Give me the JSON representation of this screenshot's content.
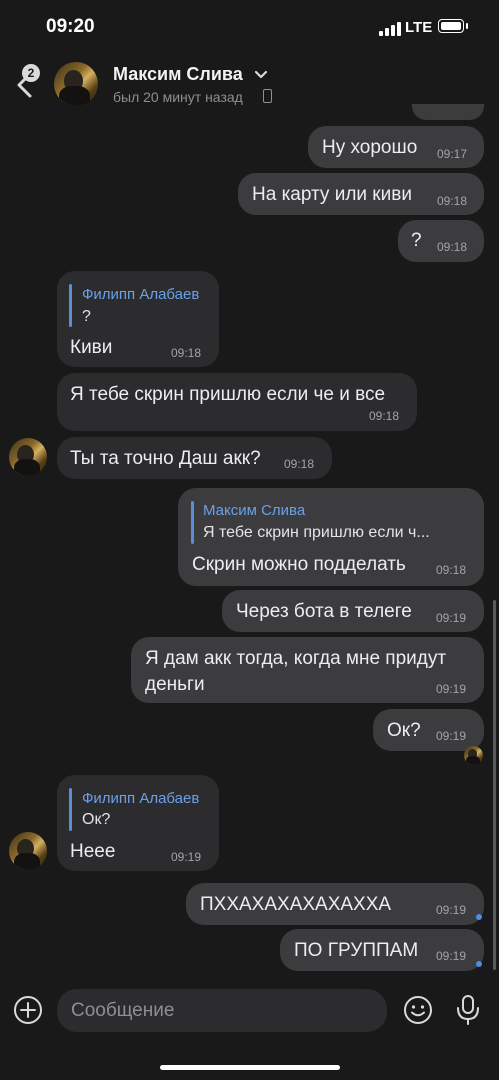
{
  "status_bar": {
    "time": "09:20",
    "network": "LTE"
  },
  "header": {
    "back_badge": "2",
    "contact_name": "Максим Слива",
    "contact_status": "был 20 минут назад"
  },
  "messages": [
    {
      "dir": "out",
      "text": "Ну хорошо",
      "time": "09:17"
    },
    {
      "dir": "out",
      "text": "На карту или киви",
      "time": "09:18"
    },
    {
      "dir": "out",
      "text": "?",
      "time": "09:18"
    },
    {
      "dir": "in",
      "reply_author": "Филипп Алабаев",
      "reply_text": "?",
      "text": "Киви",
      "time": "09:18"
    },
    {
      "dir": "in",
      "text": "Я тебе скрин пришлю если че и все",
      "time": "09:18"
    },
    {
      "dir": "in",
      "text": "Ты та точно Даш акк?",
      "time": "09:18"
    },
    {
      "dir": "out",
      "reply_author": "Максим Слива",
      "reply_text": "Я тебе скрин пришлю если ч...",
      "text": "Скрин можно подделать",
      "time": "09:18"
    },
    {
      "dir": "out",
      "text": "Через бота в телеге",
      "time": "09:19"
    },
    {
      "dir": "out",
      "text_line1": "Я дам акк тогда, когда мне придут",
      "text_line2": "деньги",
      "time": "09:19"
    },
    {
      "dir": "out",
      "text": "Ок?",
      "time": "09:19"
    },
    {
      "dir": "in",
      "reply_author": "Филипп Алабаев",
      "reply_text": "Ок?",
      "text": "Неее",
      "time": "09:19"
    },
    {
      "dir": "out",
      "text": "ПХХАХАХАХАХАХХА",
      "time": "09:19",
      "unread": true
    },
    {
      "dir": "out",
      "text": "ПО ГРУППАМ",
      "time": "09:19",
      "unread": true
    }
  ],
  "composer": {
    "placeholder": "Сообщение"
  },
  "colors": {
    "background": "#19191a",
    "bubble_out": "#3c3c3f",
    "bubble_in": "#2c2c2e",
    "accent": "#5b8ed6",
    "unread_dot": "#4a90e2"
  },
  "icons": {
    "back": "chevron-left-icon",
    "contact_menu": "chevron-down-icon",
    "phone": "phone-icon",
    "attach": "plus-circle-icon",
    "emoji": "smile-icon",
    "voice": "microphone-icon"
  }
}
